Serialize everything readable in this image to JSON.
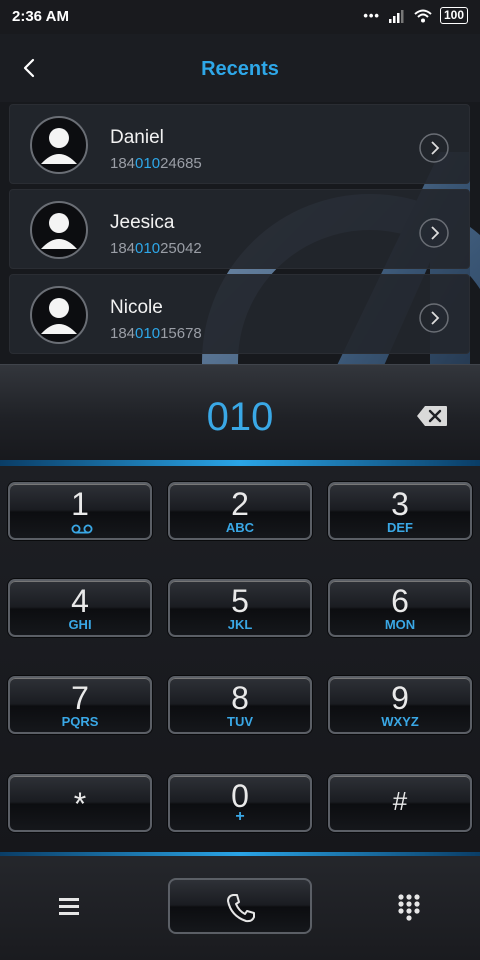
{
  "status_bar": {
    "time": "2:36 AM",
    "signal_dots": "•••",
    "battery": "100"
  },
  "header": {
    "title": "Recents",
    "back_icon": "chevron-left-icon"
  },
  "contacts": [
    {
      "name": "Daniel",
      "number_prefix": "184",
      "number_match": "010",
      "number_suffix": "24685"
    },
    {
      "name": "Jeesica",
      "number_prefix": "184",
      "number_match": "010",
      "number_suffix": "25042"
    },
    {
      "name": "Nicole",
      "number_prefix": "184",
      "number_match": "010",
      "number_suffix": "15678"
    }
  ],
  "dialer": {
    "entered_number": "010",
    "backspace_icon": "backspace-icon"
  },
  "keys": [
    {
      "digit": "1",
      "letters": ""
    },
    {
      "digit": "2",
      "letters": "ABC"
    },
    {
      "digit": "3",
      "letters": "DEF"
    },
    {
      "digit": "4",
      "letters": "GHI"
    },
    {
      "digit": "5",
      "letters": "JKL"
    },
    {
      "digit": "6",
      "letters": "MON"
    },
    {
      "digit": "7",
      "letters": "PQRS"
    },
    {
      "digit": "8",
      "letters": "TUV"
    },
    {
      "digit": "9",
      "letters": "WXYZ"
    },
    {
      "digit": "*",
      "letters": ""
    },
    {
      "digit": "0",
      "letters": "+"
    },
    {
      "digit": "#",
      "letters": ""
    }
  ],
  "bottom_bar": {
    "menu_icon": "hamburger-menu-icon",
    "call_icon": "phone-icon",
    "dialpad_icon": "dialpad-icon"
  },
  "colors": {
    "accent": "#2ea7e8",
    "background": "#1b1d22"
  }
}
